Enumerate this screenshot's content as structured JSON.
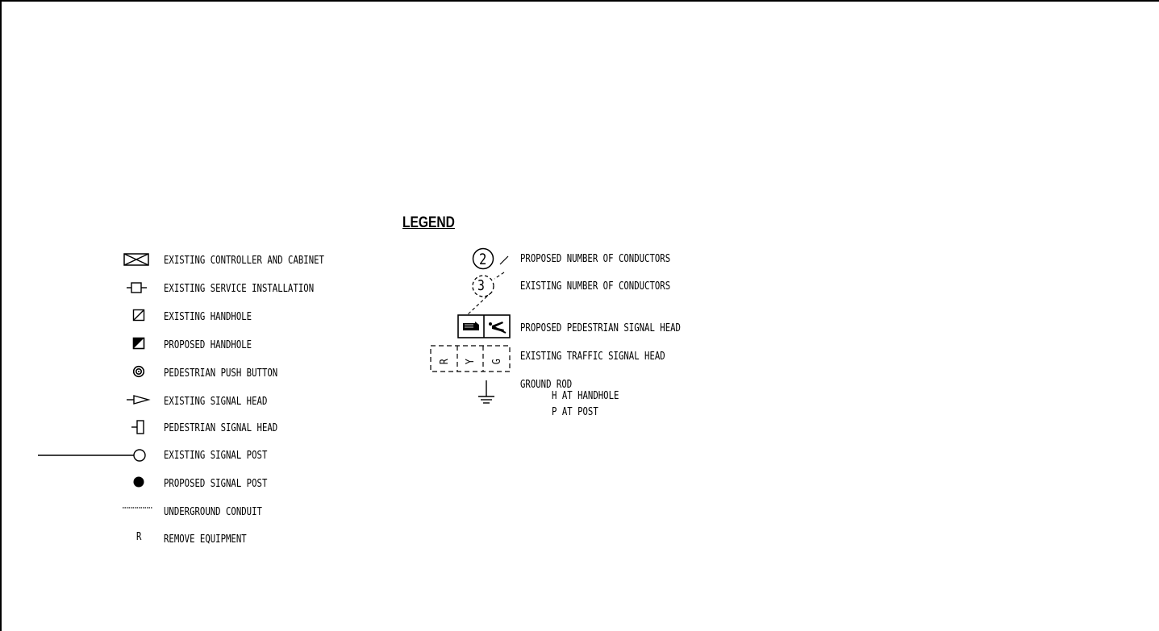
{
  "legend": {
    "title": "LEGEND",
    "left_items": [
      {
        "symbol": "controller-cabinet-icon",
        "label": "EXISTING CONTROLLER AND CABINET"
      },
      {
        "symbol": "service-installation-icon",
        "label": "EXISTING SERVICE INSTALLATION"
      },
      {
        "symbol": "existing-handhole-icon",
        "label": "EXISTING HANDHOLE"
      },
      {
        "symbol": "proposed-handhole-icon",
        "label": "PROPOSED HANDHOLE"
      },
      {
        "symbol": "push-button-icon",
        "label": "PEDESTRIAN PUSH BUTTON"
      },
      {
        "symbol": "existing-signal-head-icon",
        "label": "EXISTING SIGNAL HEAD"
      },
      {
        "symbol": "pedestrian-signal-head-icon",
        "label": "PEDESTRIAN SIGNAL HEAD"
      },
      {
        "symbol": "existing-signal-post-icon",
        "label": "EXISTING SIGNAL POST"
      },
      {
        "symbol": "proposed-signal-post-icon",
        "label": "PROPOSED SIGNAL POST"
      },
      {
        "symbol": "underground-conduit-icon",
        "label": "UNDERGROUND CONDUIT"
      },
      {
        "symbol": "remove-equipment-icon",
        "glyph": "R",
        "label": "REMOVE EQUIPMENT"
      }
    ],
    "right_items": [
      {
        "symbol": "proposed-conductors-icon",
        "glyph": "2",
        "label": "PROPOSED NUMBER OF CONDUCTORS"
      },
      {
        "symbol": "existing-conductors-icon",
        "glyph": "3",
        "label": "EXISTING NUMBER OF CONDUCTORS"
      },
      {
        "symbol": "pedestrian-signal-head-proposed-icon",
        "label": "PROPOSED PEDESTRIAN SIGNAL HEAD"
      },
      {
        "symbol": "traffic-signal-head-icon",
        "glyphs": [
          "R",
          "Y",
          "G"
        ],
        "label": "EXISTING TRAFFIC SIGNAL HEAD"
      },
      {
        "symbol": "ground-rod-icon",
        "label": "GROUND ROD",
        "sub_labels": [
          "H AT HANDHOLE",
          "P AT POST"
        ]
      }
    ]
  }
}
